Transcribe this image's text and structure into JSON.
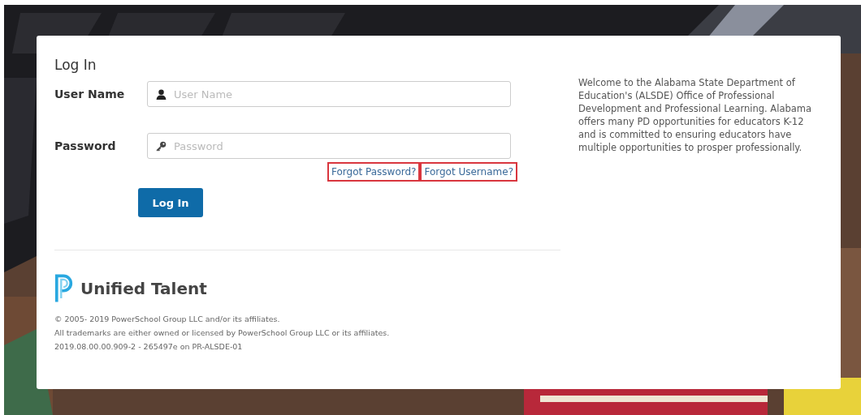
{
  "login": {
    "title": "Log In",
    "fields": [
      {
        "label": "User Name",
        "placeholder": "User Name",
        "kind": "user"
      },
      {
        "label": "Password",
        "placeholder": "Password",
        "kind": "password"
      }
    ],
    "links": [
      {
        "label": "Forgot Password?",
        "highlighted": true
      },
      {
        "label": "Forgot Username?",
        "highlighted": true
      }
    ],
    "button": "Log In"
  },
  "brand": {
    "name": "Unified Talent"
  },
  "footer": [
    "© 2005- 2019 PowerSchool Group LLC and/or its affiliates.",
    "All trademarks are either owned or licensed by PowerSchool Group LLC or its affiliates.",
    "2019.08.00.00.909-2 - 265497e on PR-ALSDE-01"
  ],
  "welcome": "Welcome to the Alabama State Department of Education's (ALSDE) Office of Professional Development and Professional Learning. Alabama offers many PD opportunities for educators K-12 and is committed to ensuring educators have multiple opportunities to prosper professionally."
}
